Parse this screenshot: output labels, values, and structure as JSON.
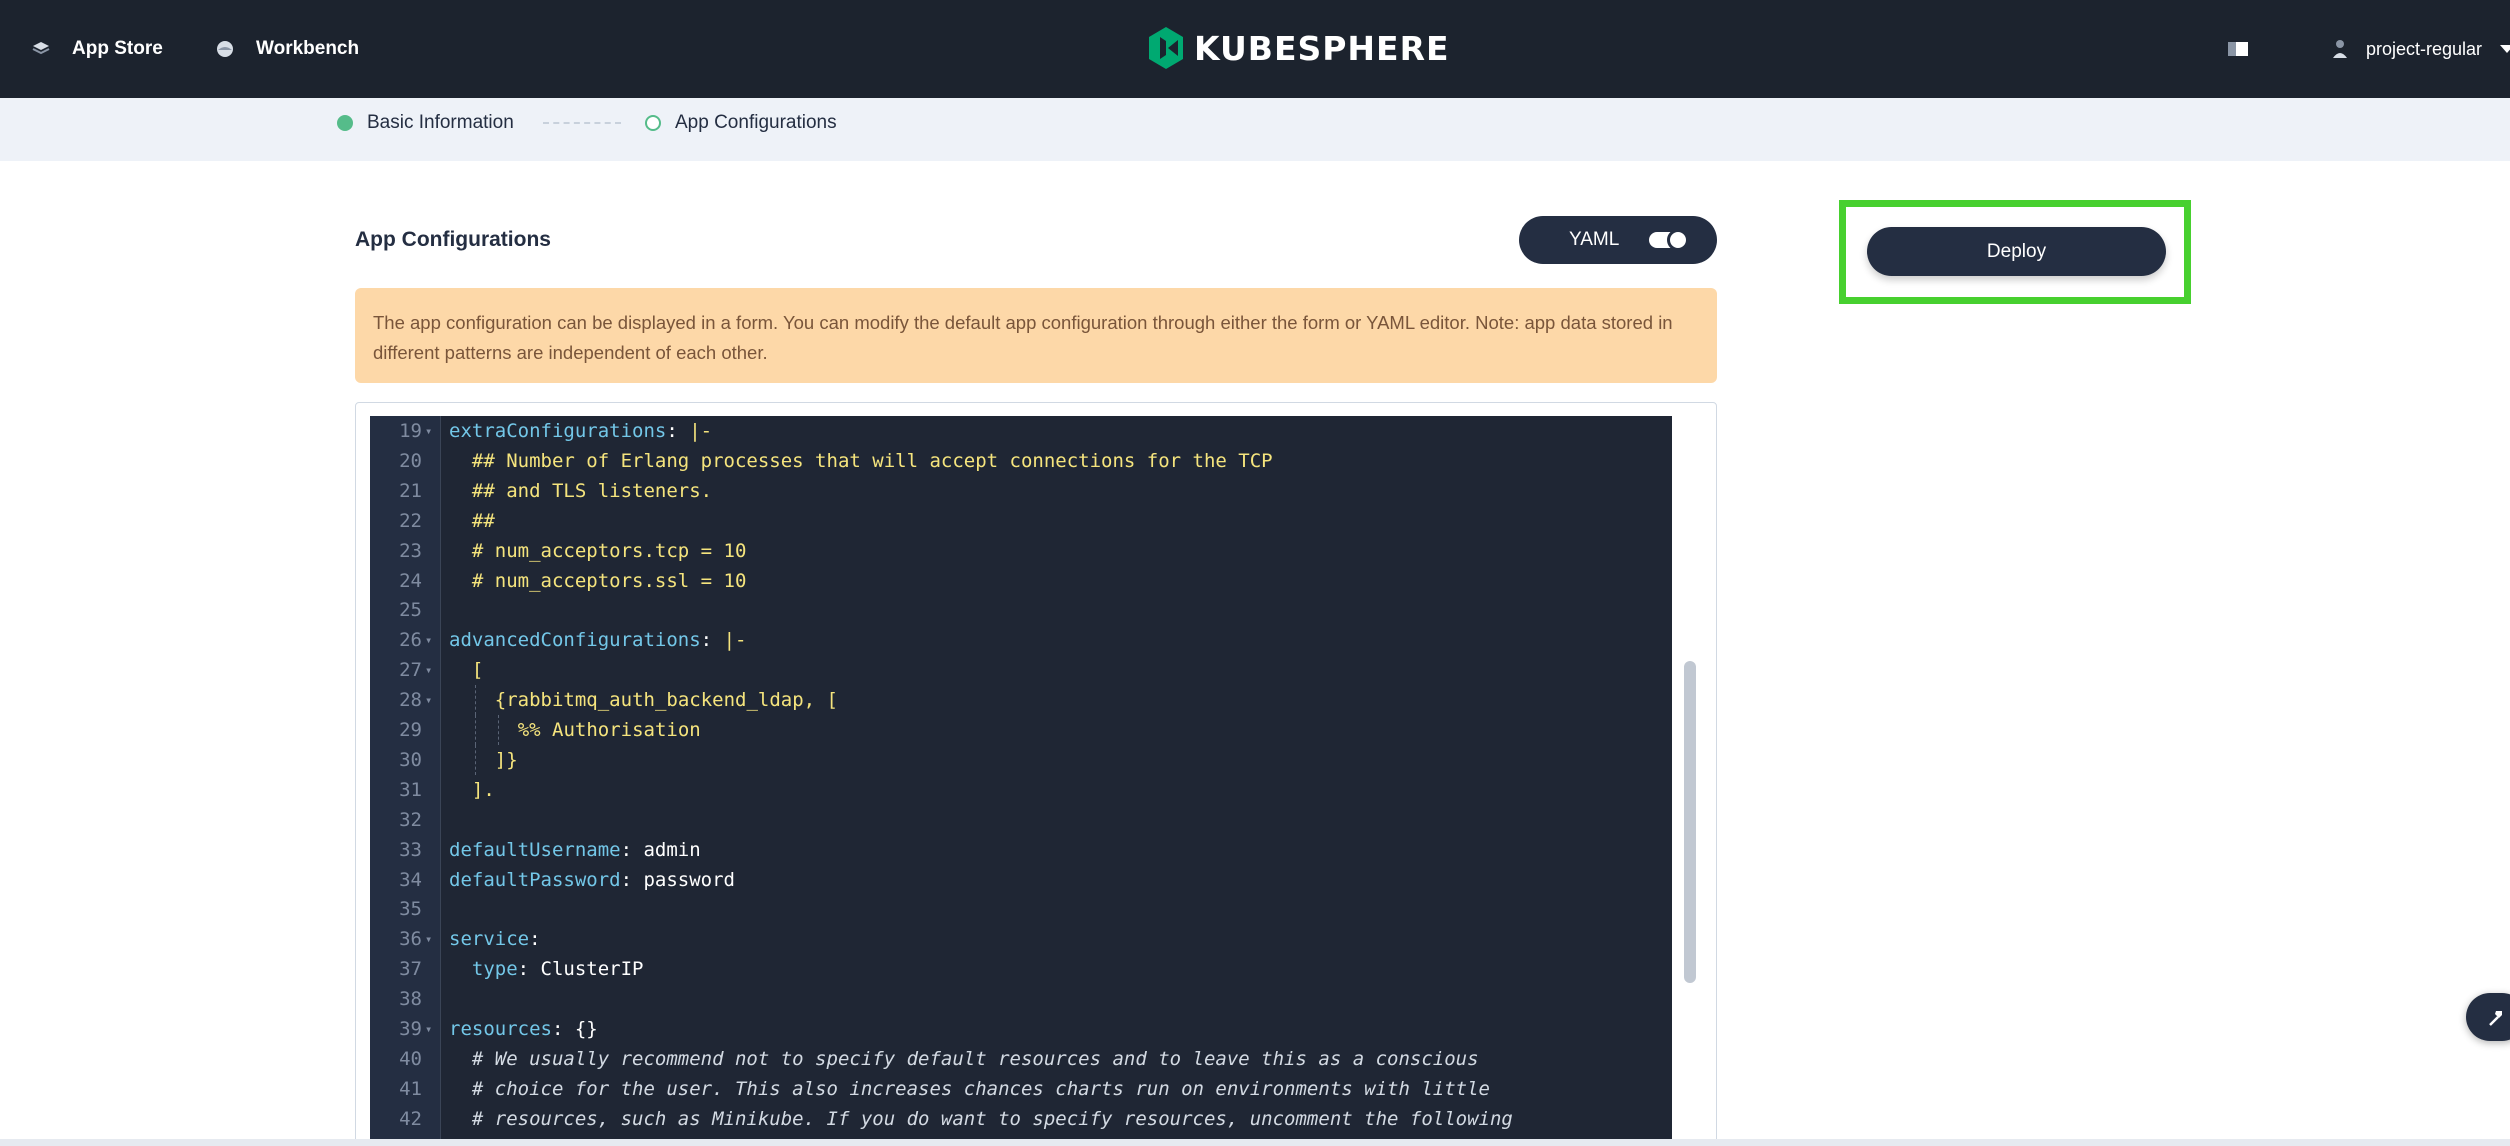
{
  "header": {
    "nav": [
      {
        "label": "App Store",
        "icon": "app-store-icon"
      },
      {
        "label": "Workbench",
        "icon": "workbench-icon"
      }
    ],
    "logo_text": "KUBESPHERE",
    "user_name": "project-regular"
  },
  "steps": [
    {
      "label": "Basic Information",
      "state": "done"
    },
    {
      "label": "App Configurations",
      "state": "current"
    }
  ],
  "section": {
    "title": "App Configurations",
    "yaml_toggle_label": "YAML",
    "yaml_enabled": true
  },
  "notice": "The app configuration can be displayed in a form. You can modify the default app configuration through either the form or YAML editor. Note: app data stored in different patterns are independent of each other.",
  "deploy_label": "Deploy",
  "colors": {
    "accent_green": "#55bc8a",
    "highlight_green": "#47d02f",
    "dark": "#242e42",
    "notice_bg": "#fdd8a8"
  },
  "editor": {
    "lines": [
      {
        "n": "19",
        "fold": true,
        "parts": [
          [
            "k",
            "extraConfigurations"
          ],
          [
            "w",
            ": "
          ],
          [
            "y",
            "|-"
          ]
        ]
      },
      {
        "n": "20",
        "indent": 2,
        "parts": [
          [
            "y",
            "## Number of Erlang processes that will accept connections for the TCP"
          ]
        ]
      },
      {
        "n": "21",
        "indent": 2,
        "parts": [
          [
            "y",
            "## and TLS listeners."
          ]
        ]
      },
      {
        "n": "22",
        "indent": 2,
        "parts": [
          [
            "y",
            "##"
          ]
        ]
      },
      {
        "n": "23",
        "indent": 2,
        "parts": [
          [
            "y",
            "# num_acceptors.tcp = 10"
          ]
        ]
      },
      {
        "n": "24",
        "indent": 2,
        "parts": [
          [
            "y",
            "# num_acceptors.ssl = 10"
          ]
        ]
      },
      {
        "n": "25",
        "parts": []
      },
      {
        "n": "26",
        "fold": true,
        "parts": [
          [
            "k",
            "advancedConfigurations"
          ],
          [
            "w",
            ": "
          ],
          [
            "y",
            "|-"
          ]
        ]
      },
      {
        "n": "27",
        "fold": true,
        "indent": 2,
        "parts": [
          [
            "y",
            "["
          ]
        ]
      },
      {
        "n": "28",
        "fold": true,
        "indent": 4,
        "guides": [
          1
        ],
        "parts": [
          [
            "y",
            "{rabbitmq_auth_backend_ldap, ["
          ]
        ]
      },
      {
        "n": "29",
        "indent": 6,
        "guides": [
          1,
          2
        ],
        "parts": [
          [
            "y",
            "%% Authorisation"
          ]
        ]
      },
      {
        "n": "30",
        "indent": 4,
        "guides": [
          1
        ],
        "parts": [
          [
            "y",
            "]}"
          ]
        ]
      },
      {
        "n": "31",
        "indent": 2,
        "parts": [
          [
            "y",
            "]."
          ]
        ]
      },
      {
        "n": "32",
        "parts": []
      },
      {
        "n": "33",
        "parts": [
          [
            "k",
            "defaultUsername"
          ],
          [
            "w",
            ": admin"
          ]
        ]
      },
      {
        "n": "34",
        "parts": [
          [
            "k",
            "defaultPassword"
          ],
          [
            "w",
            ": password"
          ]
        ]
      },
      {
        "n": "35",
        "parts": []
      },
      {
        "n": "36",
        "fold": true,
        "parts": [
          [
            "k",
            "service"
          ],
          [
            "w",
            ":"
          ]
        ]
      },
      {
        "n": "37",
        "indent": 2,
        "parts": [
          [
            "k",
            "type"
          ],
          [
            "w",
            ": ClusterIP"
          ]
        ]
      },
      {
        "n": "38",
        "parts": []
      },
      {
        "n": "39",
        "fold": true,
        "parts": [
          [
            "k",
            "resources"
          ],
          [
            "w",
            ": {}"
          ]
        ]
      },
      {
        "n": "40",
        "indent": 2,
        "parts": [
          [
            "c",
            "# We usually recommend not to specify default resources and to leave this as a conscious"
          ]
        ]
      },
      {
        "n": "41",
        "indent": 2,
        "parts": [
          [
            "c",
            "# choice for the user. This also increases chances charts run on environments with little"
          ]
        ]
      },
      {
        "n": "42",
        "indent": 2,
        "parts": [
          [
            "c",
            "# resources, such as Minikube. If you do want to specify resources, uncomment the following"
          ]
        ]
      }
    ]
  }
}
